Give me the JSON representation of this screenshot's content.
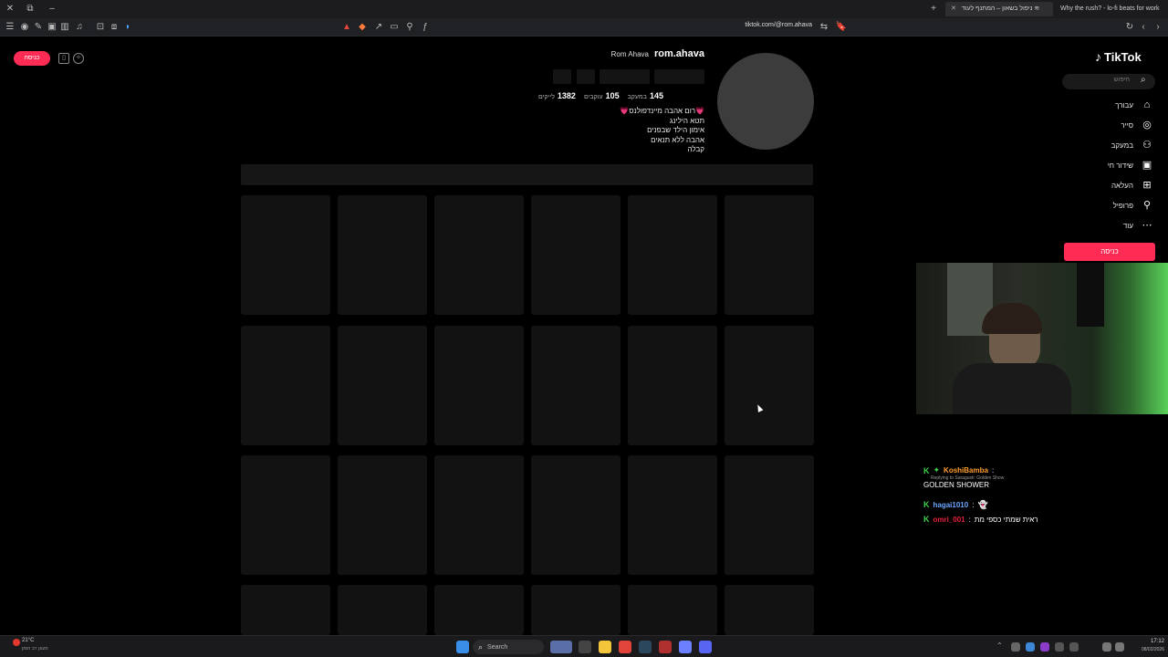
{
  "tabs": [
    {
      "label": "ניפול בשאון – המתנף לעוד ≋"
    },
    {
      "label": "Why the rush? - lo-fi beats for work"
    }
  ],
  "url": "tiktok.com/@rom.ahava",
  "tiktok": {
    "logo": "TikTok",
    "search_placeholder": "חיפוש",
    "nav": [
      {
        "label": "עבורך",
        "icon": "home-icon"
      },
      {
        "label": "סייר",
        "icon": "compass-icon"
      },
      {
        "label": "במעקב",
        "icon": "following-icon"
      },
      {
        "label": "שידור חי",
        "icon": "live-icon"
      },
      {
        "label": "העלאה",
        "icon": "upload-icon"
      },
      {
        "label": "פרופיל",
        "icon": "profile-icon"
      },
      {
        "label": "עוד",
        "icon": "more-icon"
      }
    ],
    "login_button": "כניסה",
    "top_login_button": "כניסה",
    "profile": {
      "username": "rom.ahava",
      "display_name": "Rom Ahava",
      "following_count": "145",
      "following_label": "במעקב",
      "followers_count": "105",
      "followers_label": "עוקבים",
      "likes_count": "1382",
      "likes_label": "לייקים",
      "bio": [
        "💗רום אהבה מיינדפולנס💗",
        "תטא הילינג",
        "אימון הילד שבפנים",
        "אהבה ללא תנאים",
        "קבלה"
      ]
    }
  },
  "chat": {
    "messages": [
      {
        "user": "KoshiBamba",
        "user_color": "#ff9d2e",
        "reply": "Replying to Saragusti: Golden Show",
        "text": "GOLDEN SHOWER"
      },
      {
        "user": "hagai1010",
        "user_color": "#6aa8ff",
        "reply": "",
        "text": ""
      },
      {
        "user": "omri_001",
        "user_color": "#e8213b",
        "reply": "",
        "text": "ראית שמתי כספי מת"
      }
    ]
  },
  "taskbar": {
    "weather_temp": "21°C",
    "weather_desc": "מעונן רב הזמן",
    "search_label": "Search",
    "time": "17:12",
    "date": "08/02/2026"
  },
  "colors": {
    "accent": "#fe2c55",
    "background": "#000000"
  }
}
